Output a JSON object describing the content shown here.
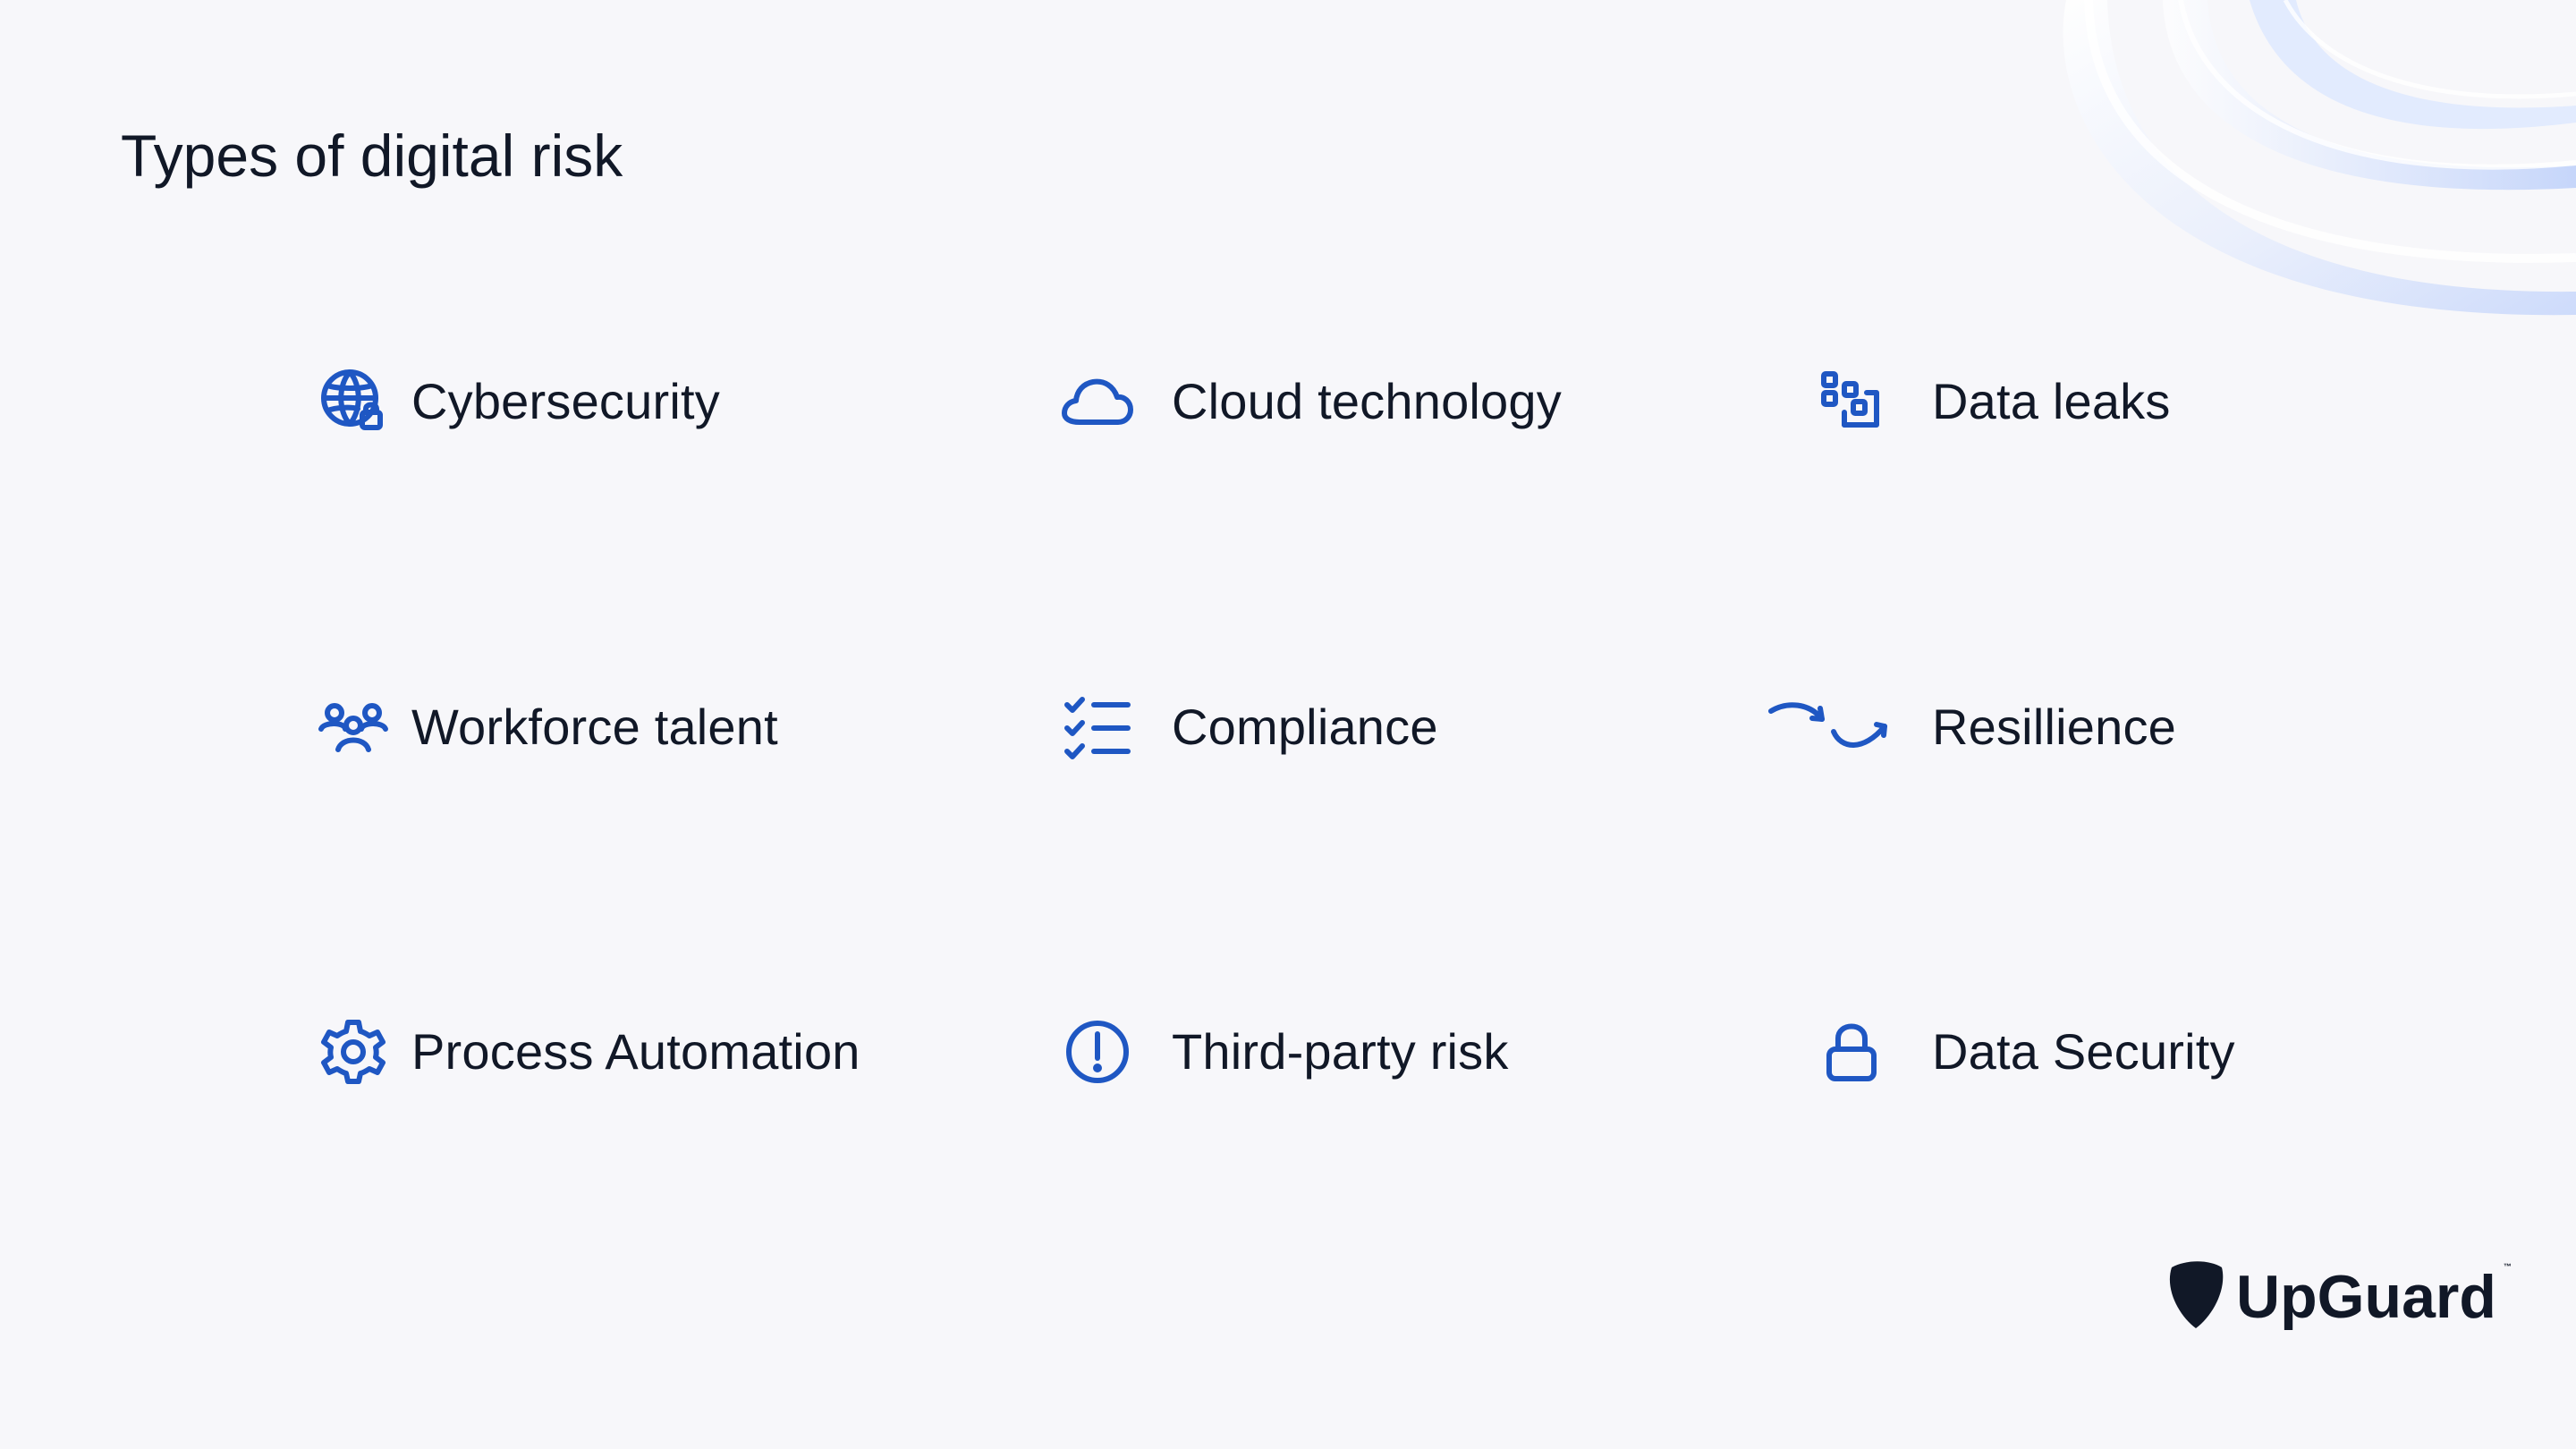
{
  "page": {
    "title": "Types of digital risk"
  },
  "risks": [
    {
      "label": "Cybersecurity",
      "icon": "globe-lock-icon"
    },
    {
      "label": "Cloud technology",
      "icon": "cloud-icon"
    },
    {
      "label": "Data leaks",
      "icon": "data-leaks-icon"
    },
    {
      "label": "Workforce talent",
      "icon": "people-icon"
    },
    {
      "label": "Compliance",
      "icon": "checklist-icon"
    },
    {
      "label": "Resillience",
      "icon": "resilience-arrows-icon"
    },
    {
      "label": "Process Automation",
      "icon": "gear-icon"
    },
    {
      "label": "Third-party risk",
      "icon": "alert-circle-icon"
    },
    {
      "label": "Data Security",
      "icon": "lock-icon"
    }
  ],
  "brand": {
    "name": "UpGuard",
    "trademark": "™",
    "accent": "#1f57c3",
    "text": "#111827",
    "background": "#f7f7fa",
    "logo_icon": "upguard-shield-logo"
  }
}
